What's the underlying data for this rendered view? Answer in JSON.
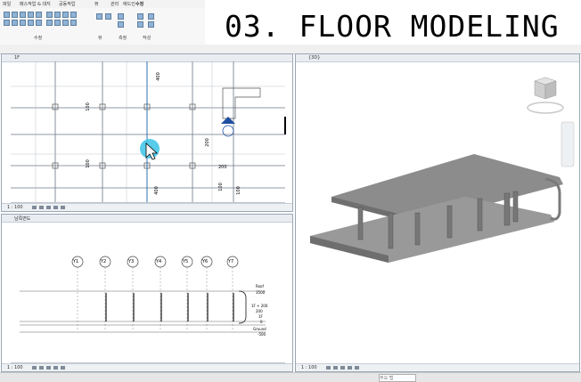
{
  "title": "03. FLOOR MODELING",
  "ribbon": {
    "tabs": [
      "파일",
      "매스작업 & 대지",
      "공동작업",
      "뷰",
      "관리",
      "애드인",
      "수정"
    ],
    "panels": [
      "수정",
      "뷰",
      "측정",
      "작성"
    ]
  },
  "views": {
    "floorplan": {
      "name": "1F",
      "scale": "1 : 100",
      "dims": [
        "400",
        "100",
        "100",
        "200",
        "200",
        "400",
        "100",
        "100"
      ]
    },
    "elevation": {
      "name": "남쪽면도",
      "scale": "1 : 100",
      "gridlines": [
        "Y1",
        "Y2",
        "Y3",
        "Y4",
        "Y5",
        "Y6",
        "Y7"
      ],
      "levels": [
        {
          "name": "Roof",
          "value": "3500"
        },
        {
          "name": "1F + 200",
          "value": "200"
        },
        {
          "name": "1F",
          "value": "0"
        },
        {
          "name": "Ground",
          "value": "-500"
        }
      ]
    },
    "threed": {
      "name": "{3D}",
      "scale": "1 : 100"
    }
  },
  "status": {
    "search_placeholder": "주요 탭"
  }
}
